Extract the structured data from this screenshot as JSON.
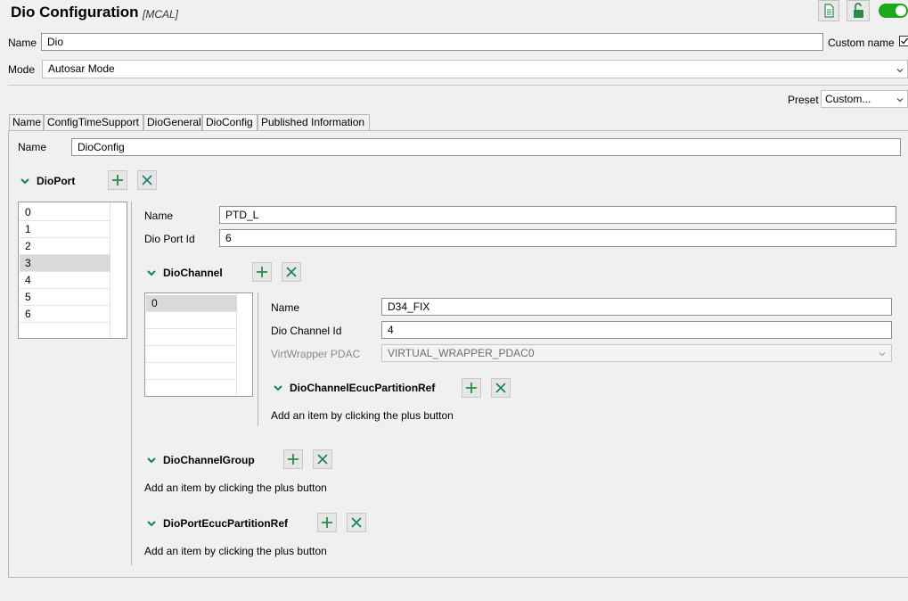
{
  "header": {
    "title": "Dio Configuration",
    "subtitle": "[MCAL]",
    "icons": [
      "file-icon",
      "lock-open-icon",
      "toggle-on-icon"
    ],
    "accent_green": "#1ca81c"
  },
  "top_form": {
    "name_label": "Name",
    "name_value": "Dio",
    "custom_name_label": "Custom name",
    "custom_name_checked": true,
    "mode_label": "Mode",
    "mode_value": "Autosar Mode",
    "preset_label": "Preset",
    "preset_value": "Custom..."
  },
  "tabs": [
    {
      "label": "Name"
    },
    {
      "label": "ConfigTimeSupport"
    },
    {
      "label": "DioGeneral"
    },
    {
      "label": "DioConfig",
      "active": true
    },
    {
      "label": "Published Information"
    }
  ],
  "dioconfig": {
    "name_label": "Name",
    "name_value": "DioConfig"
  },
  "dioport": {
    "title": "DioPort",
    "items": [
      "0",
      "1",
      "2",
      "3",
      "4",
      "5",
      "6"
    ],
    "selected_index": 3,
    "name_label": "Name",
    "name_value": "PTD_L",
    "port_id_label": "Dio Port Id",
    "port_id_value": "6"
  },
  "diochannel": {
    "title": "DioChannel",
    "items": [
      "0"
    ],
    "selected_index": 0,
    "name_label": "Name",
    "name_value": "D34_FIX",
    "channel_id_label": "Dio Channel Id",
    "channel_id_value": "4",
    "virtwrapper_label": "VirtWrapper PDAC",
    "virtwrapper_value": "VIRTUAL_WRAPPER_PDAC0"
  },
  "diochannel_ecuc": {
    "title": "DioChannelEcucPartitionRef",
    "hint": "Add an item by clicking the plus button"
  },
  "diochannelgroup": {
    "title": "DioChannelGroup",
    "hint": "Add an item by clicking the plus button"
  },
  "dioport_ecuc": {
    "title": "DioPortEcucPartitionRef",
    "hint": "Add an item by clicking the plus button"
  }
}
